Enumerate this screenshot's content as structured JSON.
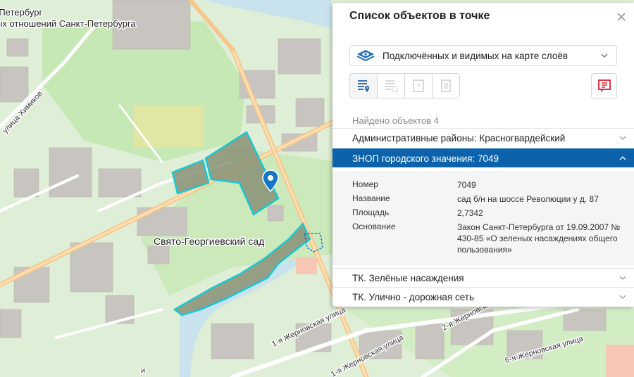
{
  "map": {
    "labels": {
      "top_left_1": "-Петербург",
      "top_left_2": "ых отношений Санкт-Петербурга",
      "street_khimikov": "улица Химиков",
      "park_name": "Свято-Георгиевский сад",
      "street_zhernovskaya_1": "1-я Жерновская улица",
      "street_zhernovskaya_2": "1-я Жерновская улица",
      "street_zhernovskaya_3": "2-я Жерновская улица",
      "street_zhernovskaya_6": "6-я Жерновская улица",
      "bottom_left": "и"
    },
    "colors": {
      "background": "#dfeed6",
      "green_area": "#c6e8b4",
      "park_fill": "#8a9176",
      "park_outline": "#19c8d4",
      "building": "#c8c5c0",
      "road_major": "#f5c78c",
      "road_minor": "#ffffff",
      "water": "#c9e3ee",
      "marker": "#1776c9"
    }
  },
  "panel": {
    "title": "Список объектов в точке",
    "close_icon": "close-icon",
    "layer_select": {
      "icon": "layers-eye-icon",
      "value": "Подключённых и видимых на карте слоёв"
    },
    "tools": [
      {
        "name": "list-with-marker-icon",
        "active": true
      },
      {
        "name": "list-grid-icon",
        "active": false
      },
      {
        "name": "frame-question-icon",
        "active": false
      },
      {
        "name": "document-icon",
        "active": false
      }
    ],
    "report_icon": "report-icon",
    "found_label": "Найдено объектов 4",
    "sections": [
      {
        "label": "Административные районы: Красногвардейский",
        "active": false
      },
      {
        "label": "ЗНОП городского значения: 7049",
        "active": true
      },
      {
        "label": "ТК. Зелёные насаждения",
        "active": false
      },
      {
        "label": "ТК. Улично - дорожная сеть",
        "active": false
      }
    ],
    "details": [
      {
        "key": "Номер",
        "value": "7049"
      },
      {
        "key": "Название",
        "value": "сад б/н на шоссе Революции у д. 87"
      },
      {
        "key": "Площадь",
        "value": "2,7342"
      },
      {
        "key": "Основание",
        "value": "Закон Санкт-Петербурга от 19.09.2007 № 430-85 «О зеленых насаждениях общего пользования»"
      }
    ],
    "accent_color": "#0d63ab"
  }
}
